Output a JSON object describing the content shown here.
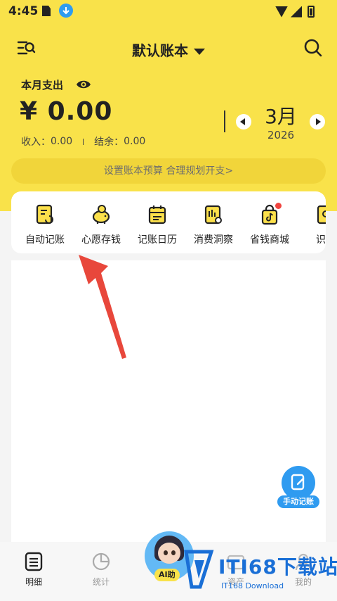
{
  "status_bar": {
    "time": "4:45"
  },
  "header": {
    "book_title": "默认账本",
    "expense_label": "本月支出",
    "expense_amount": "¥ 0.00",
    "income_label": "收入：",
    "income_value": "0.00",
    "balance_label": "结余：",
    "balance_value": "0.00",
    "month": "3月",
    "year": "2026",
    "budget_prompt": "设置账本预算 合理规划开支>"
  },
  "quick_actions": [
    {
      "label": "自动记账",
      "icon": "auto-bookkeeping-icon"
    },
    {
      "label": "心愿存钱",
      "icon": "piggy-bank-icon"
    },
    {
      "label": "记账日历",
      "icon": "calendar-icon"
    },
    {
      "label": "消费洞察",
      "icon": "insight-chart-icon"
    },
    {
      "label": "省钱商城",
      "icon": "shopping-bag-icon",
      "badge": "red-dot"
    },
    {
      "label": "识图",
      "icon": "scan-image-icon"
    }
  ],
  "floating_button": {
    "label": "手动记账"
  },
  "tab_bar": {
    "tabs": [
      {
        "label": "明细",
        "active": true
      },
      {
        "label": "统计",
        "active": false
      },
      {
        "label": "AI助手",
        "active": false
      },
      {
        "label": "资产",
        "active": false
      },
      {
        "label": "我的",
        "active": false
      }
    ],
    "ai_label": "AI助"
  },
  "watermark": {
    "main": "ITI68下载站",
    "sub": "IT168 Download"
  },
  "colors": {
    "brand_yellow": "#f9e24a",
    "accent_blue": "#2f9bf0",
    "annotation_red": "#e8473b"
  }
}
